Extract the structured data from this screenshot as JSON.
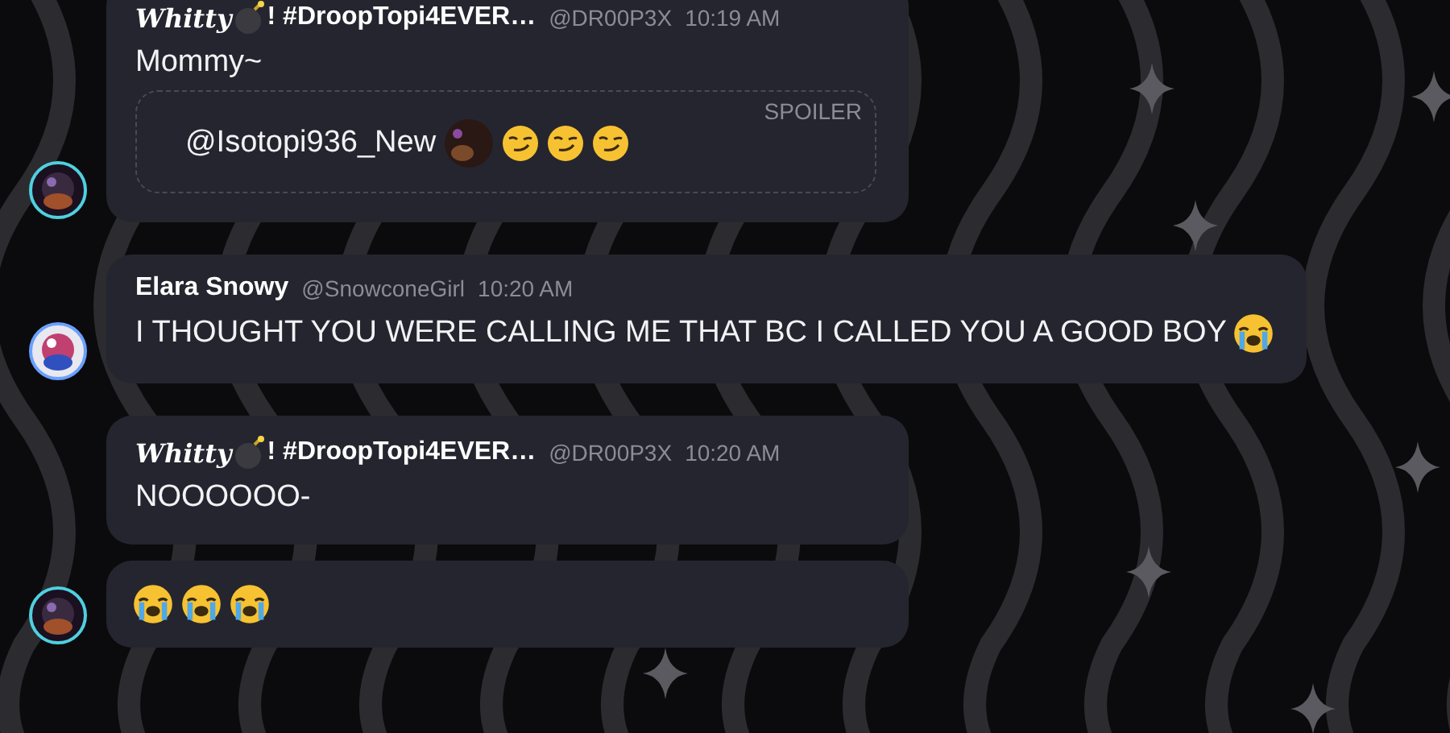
{
  "groups": [
    {
      "avatar": {
        "kind": "picture"
      },
      "bubbles": [
        {
          "header": {
            "name": "Whitty",
            "name_emoji": {
              "kind": "bomb"
            },
            "name_rest": "! #DroopTopi4EVER…",
            "handle": "@DR00P3X",
            "time": "10:19 AM"
          },
          "text": "Mommy~",
          "spoiler": {
            "label": "SPOILER",
            "mention": "@Isotopi936_New",
            "emojis": [
              {
                "kind": "custom"
              },
              {
                "kind": "smirk"
              },
              {
                "kind": "smirk"
              },
              {
                "kind": "smirk"
              }
            ]
          }
        }
      ]
    },
    {
      "avatar": {
        "kind": "picture"
      },
      "bubbles": [
        {
          "header": {
            "name": "Elara Snowy",
            "handle": "@SnowconeGirl",
            "time": "10:20 AM"
          },
          "text": "I THOUGHT YOU WERE CALLING ME THAT BC I CALLED YOU A GOOD BOY",
          "emojis": [
            {
              "kind": "crying"
            }
          ]
        }
      ]
    },
    {
      "avatar": {
        "kind": "picture"
      },
      "bubbles": [
        {
          "header": {
            "name": "Whitty",
            "name_emoji": {
              "kind": "bomb"
            },
            "name_rest": "! #DroopTopi4EVER…",
            "handle": "@DR00P3X",
            "time": "10:20 AM"
          },
          "text": "NOOOOOO-"
        },
        {
          "emojis": [
            {
              "kind": "crying"
            },
            {
              "kind": "crying"
            },
            {
              "kind": "crying"
            }
          ]
        }
      ]
    }
  ]
}
